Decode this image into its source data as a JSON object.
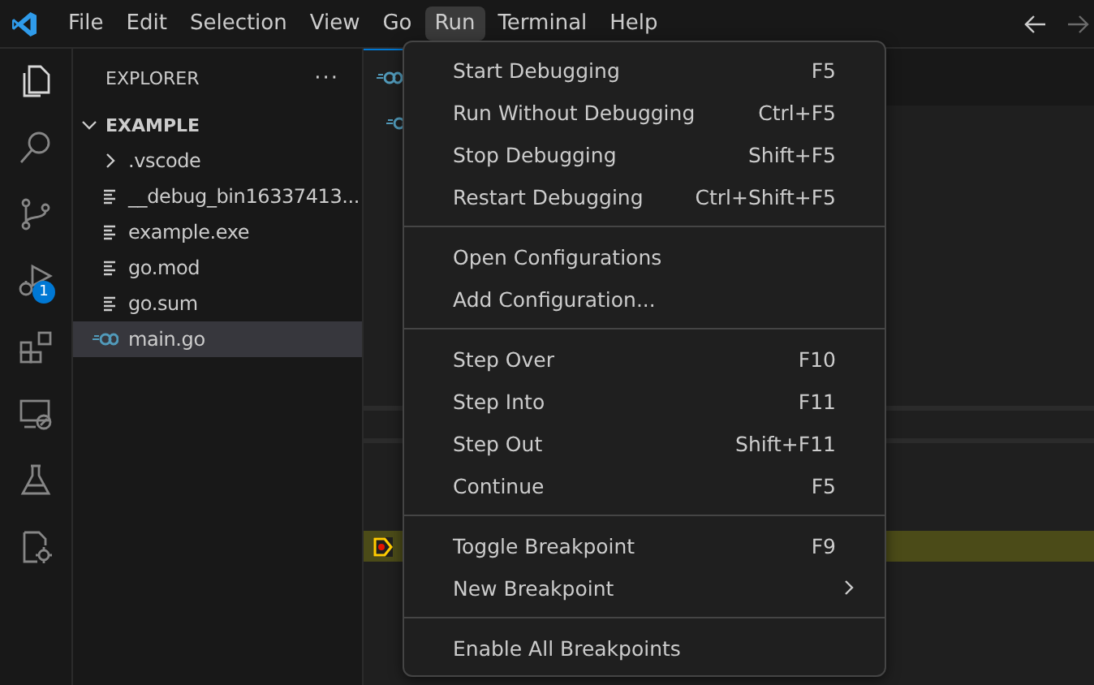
{
  "menubar": {
    "items": [
      {
        "label": "File",
        "selected": false
      },
      {
        "label": "Edit",
        "selected": false
      },
      {
        "label": "Selection",
        "selected": false
      },
      {
        "label": "View",
        "selected": false
      },
      {
        "label": "Go",
        "selected": false
      },
      {
        "label": "Run",
        "selected": true
      },
      {
        "label": "Terminal",
        "selected": false
      },
      {
        "label": "Help",
        "selected": false
      }
    ],
    "nav": [
      {
        "kind": "back",
        "disabled": false
      },
      {
        "kind": "forward",
        "disabled": true
      }
    ]
  },
  "activity_bar": [
    {
      "kind": "explorer",
      "selected": true
    },
    {
      "kind": "search",
      "selected": false
    },
    {
      "kind": "source-control",
      "selected": false
    },
    {
      "kind": "run-debug",
      "selected": false,
      "badge": "1"
    },
    {
      "kind": "extensions",
      "selected": false
    },
    {
      "kind": "remote",
      "selected": false
    },
    {
      "kind": "testing",
      "selected": false
    },
    {
      "kind": "cpp",
      "selected": false
    }
  ],
  "sidebar": {
    "title": "EXPLORER",
    "more": "···",
    "root": {
      "label": "EXAMPLE",
      "expanded": true,
      "children": [
        {
          "label": ".vscode",
          "kind": "folder",
          "expanded": false,
          "selected": false
        },
        {
          "label": "__debug_bin16337413...",
          "kind": "file",
          "selected": false
        },
        {
          "label": "example.exe",
          "kind": "file",
          "selected": false
        },
        {
          "label": "go.mod",
          "kind": "file",
          "selected": false
        },
        {
          "label": "go.sum",
          "kind": "file",
          "selected": false
        },
        {
          "label": "main.go",
          "kind": "go",
          "selected": true
        }
      ]
    }
  },
  "run_menu": {
    "groups": [
      [
        {
          "label": "Start Debugging",
          "shortcut": "F5",
          "submenu": false
        },
        {
          "label": "Run Without Debugging",
          "shortcut": "Ctrl+F5",
          "submenu": false
        },
        {
          "label": "Stop Debugging",
          "shortcut": "Shift+F5",
          "submenu": false
        },
        {
          "label": "Restart Debugging",
          "shortcut": "Ctrl+Shift+F5",
          "submenu": false
        }
      ],
      [
        {
          "label": "Open Configurations",
          "submenu": false
        },
        {
          "label": "Add Configuration...",
          "submenu": false
        }
      ],
      [
        {
          "label": "Step Over",
          "shortcut": "F10",
          "submenu": false
        },
        {
          "label": "Step Into",
          "shortcut": "F11",
          "submenu": false
        },
        {
          "label": "Step Out",
          "shortcut": "Shift+F11",
          "submenu": false
        },
        {
          "label": "Continue",
          "shortcut": "F5",
          "submenu": false
        }
      ],
      [
        {
          "label": "Toggle Breakpoint",
          "shortcut": "F9",
          "submenu": false
        },
        {
          "label": "New Breakpoint",
          "submenu": true
        }
      ],
      [
        {
          "label": "Enable All Breakpoints",
          "submenu": false
        }
      ]
    ]
  }
}
